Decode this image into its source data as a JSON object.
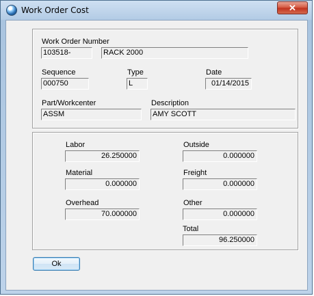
{
  "window": {
    "title": "Work Order Cost",
    "close_glyph": "✕"
  },
  "header_panel": {
    "work_order_number_label": "Work Order Number",
    "work_order_number": "103518-",
    "work_order_name": "RACK 2000",
    "sequence_label": "Sequence",
    "sequence": "000750",
    "type_label": "Type",
    "type": "L",
    "date_label": "Date",
    "date": "01/14/2015",
    "part_label": "Part/Workcenter",
    "part": "ASSM",
    "description_label": "Description",
    "description": "AMY SCOTT"
  },
  "cost_panel": {
    "labor_label": "Labor",
    "labor": "26.250000",
    "material_label": "Material",
    "material": "0.000000",
    "overhead_label": "Overhead",
    "overhead": "70.000000",
    "outside_label": "Outside",
    "outside": "0.000000",
    "freight_label": "Freight",
    "freight": "0.000000",
    "other_label": "Other",
    "other": "0.000000",
    "total_label": "Total",
    "total": "96.250000"
  },
  "buttons": {
    "ok_label": "Ok"
  },
  "icons": {
    "app_icon": "globe-icon",
    "close_icon": "close-icon"
  }
}
